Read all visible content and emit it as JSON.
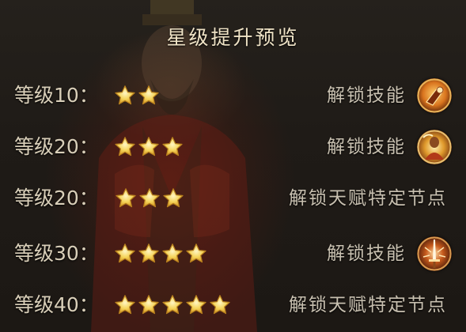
{
  "title": "星级提升预览",
  "rows": [
    {
      "level_label": "等级10：",
      "stars": 2,
      "reward": "解锁技能",
      "icon": "skill-icon-seal"
    },
    {
      "level_label": "等级20：",
      "stars": 3,
      "reward": "解锁技能",
      "icon": "skill-icon-warrior"
    },
    {
      "level_label": "等级20：",
      "stars": 3,
      "reward": "解锁天赋特定节点",
      "icon": ""
    },
    {
      "level_label": "等级30：",
      "stars": 4,
      "reward": "解锁技能",
      "icon": "skill-icon-sword"
    },
    {
      "level_label": "等级40：",
      "stars": 5,
      "reward": "解锁天赋特定节点",
      "icon": ""
    }
  ],
  "colors": {
    "title": "#efe3c6",
    "level_text": "#d9cfb9",
    "reward_text": "#c8c0b0",
    "star_fill": "#f5d45a",
    "star_edge": "#b8801e"
  }
}
